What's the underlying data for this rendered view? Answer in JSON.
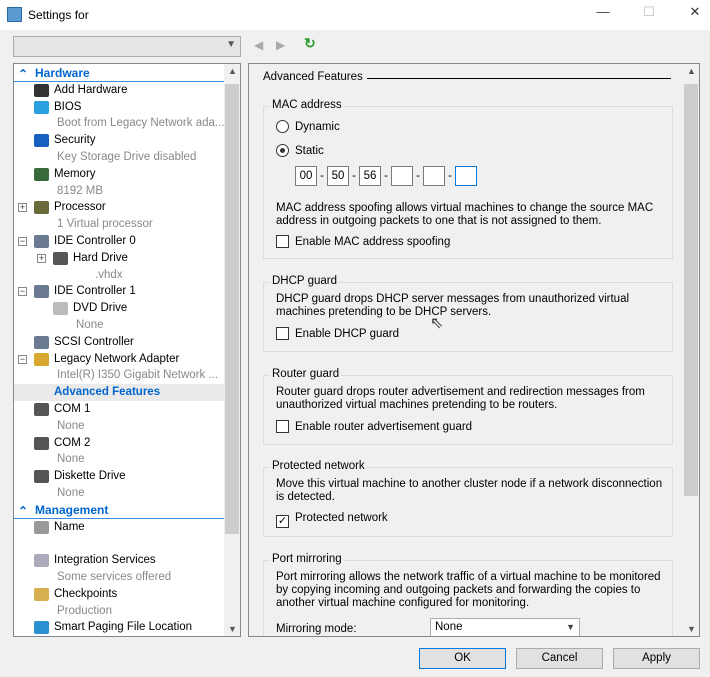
{
  "window": {
    "title": "Settings for",
    "minimize": "—",
    "maximize": "☐",
    "close": "✕"
  },
  "toolbar": {
    "back": "◀",
    "forward": "▶",
    "refresh": "↻"
  },
  "tree": [
    {
      "label": "Hardware",
      "type": "section"
    },
    {
      "label": "Add Hardware",
      "icon": "add-hardware-icon",
      "color": "#333"
    },
    {
      "label": "BIOS",
      "icon": "bios-icon",
      "color": "#2aa0e0"
    },
    {
      "label": "Boot from Legacy Network ada...",
      "type": "sub"
    },
    {
      "label": "Security",
      "icon": "shield-icon",
      "color": "#1560c0"
    },
    {
      "label": "Key Storage Drive disabled",
      "type": "sub"
    },
    {
      "label": "Memory",
      "icon": "memory-icon",
      "color": "#3a6a3a"
    },
    {
      "label": "8192 MB",
      "type": "sub"
    },
    {
      "label": "Processor",
      "icon": "processor-icon",
      "color": "#6a6a3a",
      "expander": "+"
    },
    {
      "label": "1 Virtual processor",
      "type": "sub"
    },
    {
      "label": "IDE Controller 0",
      "icon": "ide-controller-icon",
      "color": "#6a7a90",
      "expander": "−"
    },
    {
      "label": "Hard Drive",
      "icon": "hard-drive-icon",
      "color": "#555",
      "expander": "+",
      "indent": 1
    },
    {
      "label": ".vhdx",
      "type": "sub",
      "indent": 2
    },
    {
      "label": "IDE Controller 1",
      "icon": "ide-controller-icon",
      "color": "#6a7a90",
      "expander": "−"
    },
    {
      "label": "DVD Drive",
      "icon": "dvd-icon",
      "color": "#bbb",
      "indent": 1
    },
    {
      "label": "None",
      "type": "sub",
      "indent": 1
    },
    {
      "label": "SCSI Controller",
      "icon": "scsi-controller-icon",
      "color": "#6a7a90"
    },
    {
      "label": "Legacy Network Adapter",
      "icon": "network-adapter-icon",
      "color": "#d8a830",
      "expander": "−"
    },
    {
      "label": "Intel(R) I350 Gigabit Network ...",
      "type": "sub"
    },
    {
      "label": "Advanced Features",
      "type": "selected"
    },
    {
      "label": "COM 1",
      "icon": "com-port-icon",
      "color": "#555"
    },
    {
      "label": "None",
      "type": "sub"
    },
    {
      "label": "COM 2",
      "icon": "com-port-icon",
      "color": "#555"
    },
    {
      "label": "None",
      "type": "sub"
    },
    {
      "label": "Diskette Drive",
      "icon": "diskette-icon",
      "color": "#555"
    },
    {
      "label": "None",
      "type": "sub"
    },
    {
      "label": "Management",
      "type": "section"
    },
    {
      "label": "Name",
      "icon": "name-icon",
      "color": "#999"
    },
    {
      "label": "",
      "type": "sub"
    },
    {
      "label": "Integration Services",
      "icon": "integration-services-icon",
      "color": "#aab"
    },
    {
      "label": "Some services offered",
      "type": "sub"
    },
    {
      "label": "Checkpoints",
      "icon": "checkpoints-icon",
      "color": "#d8b050"
    },
    {
      "label": "Production",
      "type": "sub"
    },
    {
      "label": "Smart Paging File Location",
      "icon": "smart-paging-icon",
      "color": "#2a90d0"
    }
  ],
  "panel": {
    "heading": "Advanced Features",
    "mac": {
      "label": "MAC address",
      "dynamic": "Dynamic",
      "static": "Static",
      "selected": "Static",
      "octets": [
        "00",
        "50",
        "56",
        "",
        "",
        ""
      ],
      "separator": "-",
      "desc": "MAC address spoofing allows virtual machines to change the source MAC address in outgoing packets to one that is not assigned to them.",
      "spoof_label": "Enable MAC address spoofing",
      "spoof_checked": false
    },
    "dhcp": {
      "label": "DHCP guard",
      "desc": "DHCP guard drops DHCP server messages from unauthorized virtual machines pretending to be DHCP servers.",
      "cb": "Enable DHCP guard",
      "checked": false
    },
    "router": {
      "label": "Router guard",
      "desc": "Router guard drops router advertisement and redirection messages from unauthorized virtual machines pretending to be routers.",
      "cb": "Enable router advertisement guard",
      "checked": false
    },
    "protected": {
      "label": "Protected network",
      "desc": "Move this virtual machine to another cluster node if a network disconnection is detected.",
      "cb": "Protected network",
      "checked": true,
      "mark": "✓"
    },
    "mirror": {
      "label": "Port mirroring",
      "desc": "Port mirroring allows the network traffic of a virtual machine to be monitored by copying incoming and outgoing packets and forwarding the copies to another virtual machine configured for monitoring.",
      "mode_label": "Mirroring mode:",
      "mode_value": "None"
    }
  },
  "buttons": {
    "ok": "OK",
    "cancel": "Cancel",
    "apply": "Apply"
  }
}
